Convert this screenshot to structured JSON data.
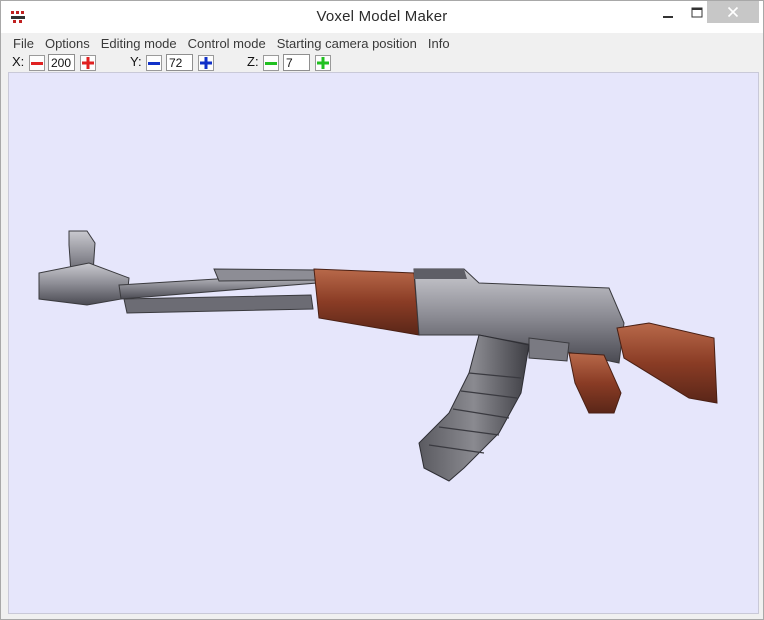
{
  "window": {
    "title": "Voxel Model Maker",
    "controls": {
      "minimize": "minimize",
      "maximize": "maximize",
      "close": "close"
    }
  },
  "menu": {
    "items": [
      {
        "label": "File"
      },
      {
        "label": "Options"
      },
      {
        "label": "Editing mode"
      },
      {
        "label": "Control mode"
      },
      {
        "label": "Starting camera position"
      },
      {
        "label": "Info"
      }
    ]
  },
  "toolbar": {
    "x": {
      "label": "X:",
      "value": "200",
      "color": "#e02020"
    },
    "y": {
      "label": "Y:",
      "value": "72",
      "color": "#1030c8"
    },
    "z": {
      "label": "Z:",
      "value": "7",
      "color": "#20c020"
    }
  },
  "viewport": {
    "background": "#e6e6fb",
    "model": "voxel-assault-rifle"
  },
  "icons": {
    "app": "voxel-app-icon",
    "decrement": "minus-icon",
    "increment": "plus-icon"
  }
}
